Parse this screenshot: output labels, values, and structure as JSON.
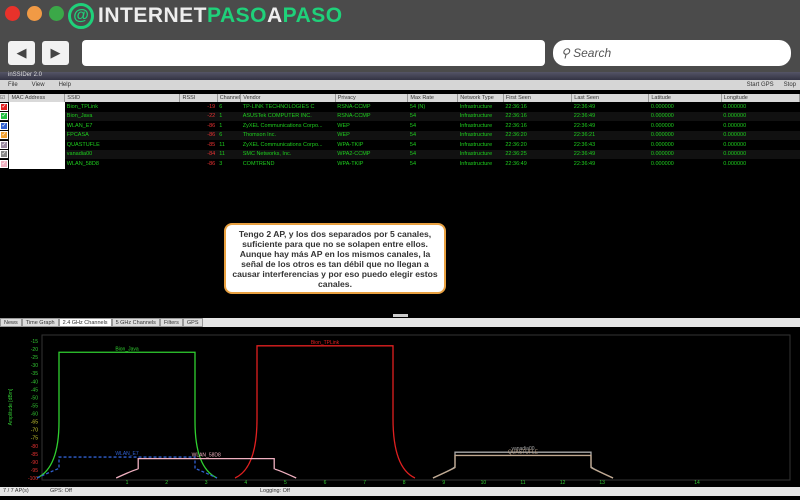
{
  "browser": {
    "logo_text_white_1": "INTERNET",
    "logo_text_green_1": "PASO",
    "logo_text_white_2": "A",
    "logo_text_green_2": "PASO",
    "back": "◀",
    "forward": "▶",
    "search_placeholder": "Search",
    "url": ""
  },
  "app": {
    "title": "inSSIDer 2.0",
    "menu": [
      "File",
      "View",
      "Help"
    ],
    "start_gps": "Start GPS",
    "stop": "Stop",
    "columns": [
      "MAC Address",
      "SSID",
      "RSSI",
      "Channel",
      "Vendor",
      "Privacy",
      "Max Rate",
      "Network Type",
      "First Seen",
      "Last Seen",
      "Latitude",
      "Longitude"
    ],
    "rows": [
      {
        "color": "#e02020",
        "ssid": "Bion_TPLink",
        "rssi": "-19",
        "channel": "6",
        "vendor": "TP-LINK TECHNOLOGIES C",
        "privacy": "RSNA-CCMP",
        "rate": "54 (N)",
        "type": "Infrastructure",
        "first": "22:36:16",
        "last": "22:36:49",
        "lat": "0.000000",
        "lon": "0.000000"
      },
      {
        "color": "#20c040",
        "ssid": "Bion_Java",
        "rssi": "-22",
        "channel": "1",
        "vendor": "ASUSTek COMPUTER INC.",
        "privacy": "RSNA-CCMP",
        "rate": "54",
        "type": "Infrastructure",
        "first": "22:36:16",
        "last": "22:36:49",
        "lat": "0.000000",
        "lon": "0.000000"
      },
      {
        "color": "#3060d0",
        "ssid": "WLAN_E7",
        "rssi": "-86",
        "channel": "1",
        "vendor": "ZyXEL Communications Corpo...",
        "privacy": "WEP",
        "rate": "54",
        "type": "Infrastructure",
        "first": "22:36:16",
        "last": "22:36:49",
        "lat": "0.000000",
        "lon": "0.000000"
      },
      {
        "color": "#f0a030",
        "ssid": "FPCASA",
        "rssi": "-86",
        "channel": "6",
        "vendor": "Thomson Inc.",
        "privacy": "WEP",
        "rate": "54",
        "type": "Infrastructure",
        "first": "22:36:20",
        "last": "22:36:21",
        "lat": "0.000000",
        "lon": "0.000000"
      },
      {
        "color": "#9a8aa0",
        "ssid": "QUASTUFLE",
        "rssi": "-85",
        "channel": "11",
        "vendor": "ZyXEL Communications Corpo...",
        "privacy": "WPA-TKIP",
        "rate": "54",
        "type": "Infrastructure",
        "first": "22:36:20",
        "last": "22:36:43",
        "lat": "0.000000",
        "lon": "0.000000"
      },
      {
        "color": "#888888",
        "ssid": "vanadia00",
        "rssi": "-84",
        "channel": "11",
        "vendor": "SMC Networks, Inc.",
        "privacy": "WPA2-CCMP",
        "rate": "54",
        "type": "Infrastructure",
        "first": "22:36:25",
        "last": "22:36:49",
        "lat": "0.000000",
        "lon": "0.000000"
      },
      {
        "color": "#f0b0c0",
        "ssid": "WLAN_58D8",
        "rssi": "-86",
        "channel": "3",
        "vendor": "COMTREND",
        "privacy": "WPA-TKIP",
        "rate": "54",
        "type": "Infrastructure",
        "first": "22:36:49",
        "last": "22:36:49",
        "lat": "0.000000",
        "lon": "0.000000"
      }
    ],
    "note": "Tengo 2 AP, y los dos separados por 5 canales, suficiente para que no se solapen entre ellos. Aunque hay más AP en los mismos canales, la señal de los otros es tan débil que no llegan a causar interferencias y por eso puedo elegir estos canales.",
    "tabs": [
      "News",
      "Time Graph",
      "2.4 GHz Channels",
      "5 GHz Channels",
      "Filters",
      "GPS"
    ],
    "status": {
      "aps": "7 / 7 AP(s)",
      "gps": "GPS: Off",
      "logging": "Logging: Off"
    }
  },
  "chart_data": {
    "type": "area",
    "ylabel": "Amplitude [dBm]",
    "ylim": [
      -100,
      -15
    ],
    "yticks": [
      -15,
      -20,
      -25,
      -30,
      -35,
      -40,
      -45,
      -50,
      -55,
      -60,
      -65,
      -70,
      -75,
      -80,
      -85,
      -90,
      -95,
      -100
    ],
    "xticks": [
      1,
      2,
      3,
      4,
      5,
      6,
      7,
      8,
      9,
      10,
      11,
      12,
      13,
      14
    ],
    "series": [
      {
        "name": "Bion_Java",
        "channel": 1,
        "amplitude": -22,
        "color": "#30d030"
      },
      {
        "name": "Bion_TPLink",
        "channel": 6,
        "amplitude": -18,
        "color": "#e02020"
      },
      {
        "name": "WLAN_E7",
        "channel": 1,
        "amplitude": -87,
        "color": "#3060d0",
        "dashed": true
      },
      {
        "name": "WLAN_58D8",
        "channel": 3,
        "amplitude": -88,
        "color": "#f0b0c0"
      },
      {
        "name": "vanadia00",
        "channel": 11,
        "amplitude": -84,
        "color": "#aaaaaa"
      },
      {
        "name": "QUASTUFLE",
        "channel": 11,
        "amplitude": -86,
        "color": "#c0a890"
      }
    ]
  }
}
